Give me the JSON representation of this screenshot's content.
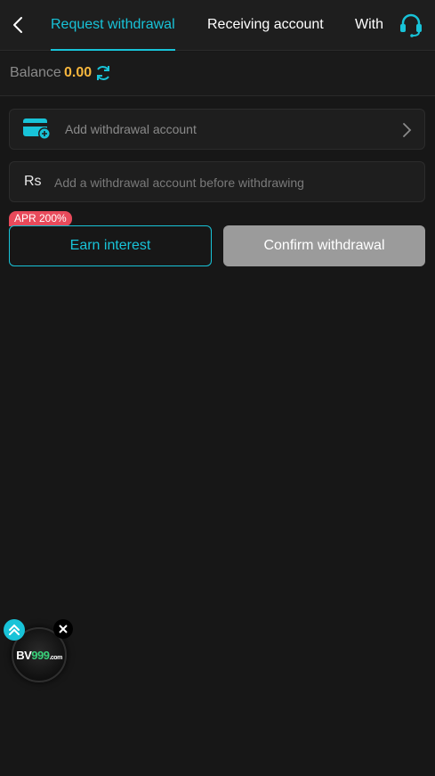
{
  "header": {
    "tabs": [
      {
        "label": "Request withdrawal",
        "active": true
      },
      {
        "label": "Receiving account",
        "active": false
      },
      {
        "label": "With",
        "active": false
      }
    ],
    "back_icon": "chevron-left-icon",
    "support_icon": "headset-icon"
  },
  "balance": {
    "label": "Balance",
    "value": "0.00",
    "refresh_icon": "refresh-icon"
  },
  "account": {
    "placeholder": "Add withdrawal account",
    "icon": "card-add-icon"
  },
  "amount": {
    "currency": "Rs",
    "placeholder": "Add a withdrawal account before withdrawing"
  },
  "actions": {
    "apr_badge": "APR 200%",
    "earn_label": "Earn interest",
    "confirm_label": "Confirm withdrawal"
  },
  "floating": {
    "brand_prefix": "BV",
    "brand_number": "999",
    "brand_suffix": ".com"
  },
  "colors": {
    "accent": "#18c3d8",
    "balance": "#f6b63d",
    "badge": "#e84a5b",
    "disabled_button": "#9b9b9b",
    "background": "#171717"
  }
}
